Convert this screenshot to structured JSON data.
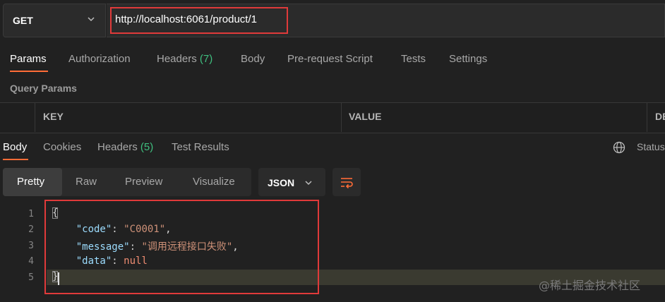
{
  "request": {
    "method": "GET",
    "url": "http://localhost:6061/product/1"
  },
  "request_tabs": [
    {
      "label": "Params",
      "count": ""
    },
    {
      "label": "Authorization",
      "count": ""
    },
    {
      "label": "Headers",
      "count": "(7)"
    },
    {
      "label": "Body",
      "count": ""
    },
    {
      "label": "Pre-request Script",
      "count": ""
    },
    {
      "label": "Tests",
      "count": ""
    },
    {
      "label": "Settings",
      "count": ""
    }
  ],
  "query_params": {
    "title": "Query Params",
    "columns": [
      "KEY",
      "VALUE",
      "DE"
    ]
  },
  "response_tabs": [
    {
      "label": "Body",
      "count": ""
    },
    {
      "label": "Cookies",
      "count": ""
    },
    {
      "label": "Headers",
      "count": "(5)"
    },
    {
      "label": "Test Results",
      "count": ""
    }
  ],
  "status_label": "Status",
  "view_modes": [
    "Pretty",
    "Raw",
    "Preview",
    "Visualize"
  ],
  "format": "JSON",
  "code": {
    "line_numbers": [
      "1",
      "2",
      "3",
      "4",
      "5"
    ],
    "open_brace": "{",
    "close_brace": "}",
    "entries": [
      {
        "key": "\"code\"",
        "value": "\"C0001\"",
        "suffix": ","
      },
      {
        "key": "\"message\"",
        "value": "\"调用远程接口失败\"",
        "suffix": ","
      },
      {
        "key": "\"data\"",
        "value": "null",
        "suffix": ""
      }
    ]
  },
  "watermark": "@稀土掘金技术社区",
  "colors": {
    "accent": "#ff6c37",
    "highlight_box": "#e03a3a",
    "count_green": "#3fbf7f"
  }
}
